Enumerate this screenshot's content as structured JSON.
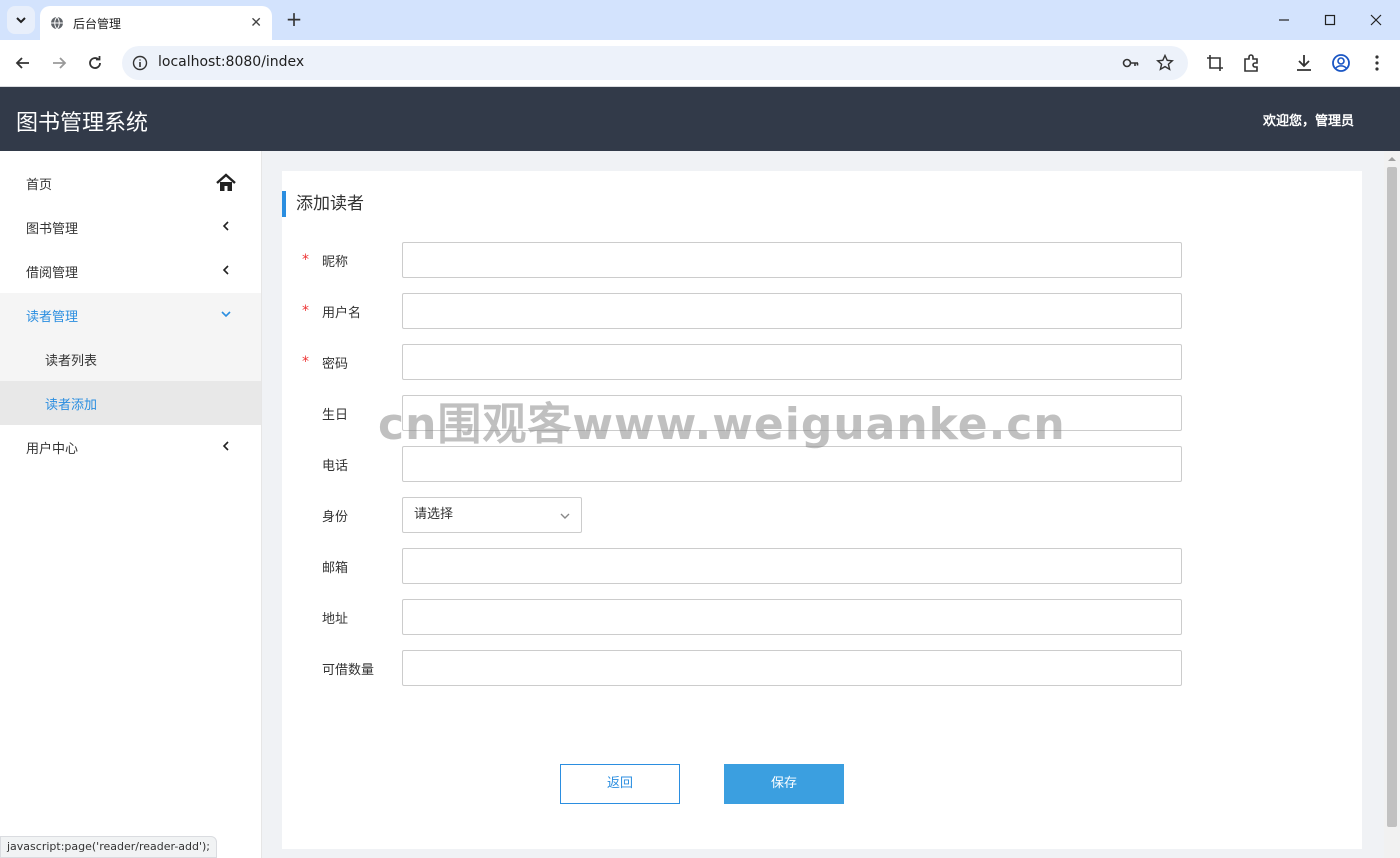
{
  "browser": {
    "tab_title": "后台管理",
    "url": "localhost:8080/index",
    "status_tip": "javascript:page('reader/reader-add');"
  },
  "app": {
    "title": "图书管理系统",
    "welcome": "欢迎您，管理员"
  },
  "sidebar": {
    "items": [
      {
        "label": "首页",
        "icon": "home-icon"
      },
      {
        "label": "图书管理",
        "icon": "chevron-left-icon"
      },
      {
        "label": "借阅管理",
        "icon": "chevron-left-icon"
      },
      {
        "label": "读者管理",
        "icon": "chevron-down-icon"
      },
      {
        "label": "读者列表"
      },
      {
        "label": "读者添加"
      },
      {
        "label": "用户中心",
        "icon": "chevron-left-icon"
      }
    ]
  },
  "form": {
    "title": "添加读者",
    "fields": [
      {
        "label": "昵称",
        "required": "*",
        "value": ""
      },
      {
        "label": "用户名",
        "required": "*",
        "value": ""
      },
      {
        "label": "密码",
        "required": "*",
        "value": ""
      },
      {
        "label": "生日",
        "value": ""
      },
      {
        "label": "电话",
        "value": ""
      },
      {
        "label": "身份",
        "selected": "请选择"
      },
      {
        "label": "邮箱",
        "value": ""
      },
      {
        "label": "地址",
        "value": ""
      },
      {
        "label": "可借数量",
        "value": ""
      }
    ],
    "back_label": "返回",
    "save_label": "保存"
  },
  "watermark": "cn围观客www.weiguanke.cn",
  "colors": {
    "header_bg": "#323a49",
    "accent": "#2b8ee0",
    "save_bg": "#3b9fe0",
    "required": "#e33333"
  }
}
